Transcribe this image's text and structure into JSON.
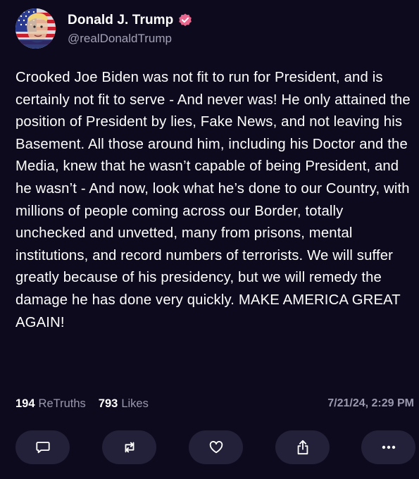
{
  "author": {
    "display_name": "Donald J. Trump",
    "handle": "@realDonaldTrump",
    "avatar_icon": "flag-portrait-avatar",
    "verified_icon": "verified-badge-icon",
    "verified_color": "#e8678e"
  },
  "post": {
    "text": "Crooked Joe Biden was not fit to run for President, and is certainly not fit to serve - And never was! He only attained the position of President by lies, Fake News, and not leaving his Basement. All those around him, including his Doctor and the Media, knew that he wasn’t capable of being President, and he wasn’t - And now, look what he’s done to our Country, with millions of people coming across our Border, totally unchecked and unvetted, many from prisons, mental institutions, and record numbers of terrorists. We will suffer greatly because of his presidency, but we will remedy the damage he has done very quickly. MAKE AMERICA GREAT AGAIN!"
  },
  "stats": {
    "retruths_count": "194",
    "retruths_label": "ReTruths",
    "likes_count": "793",
    "likes_label": "Likes",
    "timestamp": "7/21/24, 2:29 PM"
  },
  "actions": [
    {
      "name": "reply",
      "icon": "speech-bubble-icon"
    },
    {
      "name": "retruth",
      "icon": "repost-arrows-icon"
    },
    {
      "name": "like",
      "icon": "heart-icon"
    },
    {
      "name": "share",
      "icon": "share-upload-icon"
    },
    {
      "name": "more",
      "icon": "more-dots-icon"
    }
  ],
  "colors": {
    "background": "#0d0a1e",
    "button_bg": "#23213a",
    "muted_text": "#9a98ad"
  }
}
